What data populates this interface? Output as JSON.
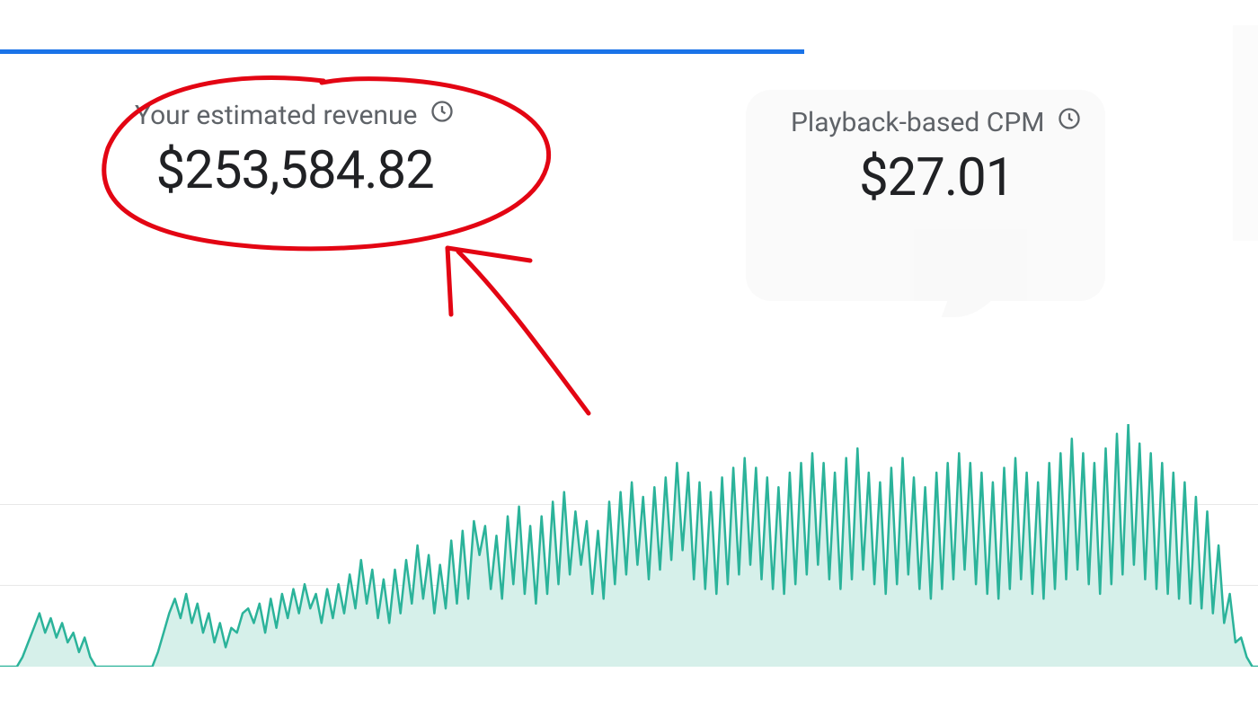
{
  "metrics": {
    "revenue": {
      "label": "Your estimated revenue",
      "value": "$253,584.82"
    },
    "cpm": {
      "label": "Playback-based CPM",
      "value": "$27.01"
    }
  },
  "colors": {
    "accent": "#1a73e8",
    "chart_line": "#2bb39a",
    "chart_fill": "#d6f0ea",
    "annotation": "#e30513"
  },
  "chart_data": {
    "type": "area",
    "title": "",
    "xlabel": "",
    "ylabel": "",
    "ylim": [
      0,
      100
    ],
    "values": [
      0,
      0,
      0,
      0,
      4,
      10,
      16,
      22,
      14,
      20,
      12,
      18,
      10,
      14,
      6,
      12,
      4,
      0,
      0,
      0,
      0,
      0,
      0,
      0,
      0,
      0,
      0,
      0,
      6,
      14,
      22,
      28,
      20,
      30,
      18,
      26,
      14,
      22,
      10,
      18,
      8,
      16,
      14,
      22,
      24,
      18,
      26,
      14,
      28,
      16,
      30,
      20,
      32,
      22,
      34,
      24,
      30,
      18,
      32,
      20,
      34,
      22,
      38,
      24,
      44,
      26,
      40,
      20,
      36,
      18,
      40,
      22,
      44,
      26,
      50,
      28,
      46,
      22,
      42,
      24,
      52,
      26,
      56,
      28,
      60,
      46,
      58,
      32,
      54,
      28,
      62,
      34,
      66,
      30,
      58,
      26,
      62,
      30,
      68,
      34,
      72,
      38,
      64,
      42,
      60,
      30,
      56,
      28,
      68,
      34,
      72,
      38,
      76,
      42,
      70,
      36,
      74,
      40,
      78,
      44,
      84,
      48,
      80,
      36,
      76,
      32,
      72,
      30,
      78,
      34,
      82,
      38,
      86,
      42,
      82,
      36,
      78,
      32,
      74,
      30,
      80,
      34,
      84,
      38,
      88,
      42,
      84,
      36,
      80,
      32,
      86,
      36,
      90,
      40,
      80,
      34,
      76,
      30,
      82,
      34,
      86,
      38,
      78,
      32,
      74,
      28,
      80,
      32,
      84,
      36,
      88,
      40,
      84,
      34,
      80,
      30,
      76,
      28,
      82,
      32,
      86,
      36,
      80,
      30,
      76,
      28,
      84,
      32,
      88,
      36,
      94,
      40,
      88,
      34,
      84,
      30,
      90,
      34,
      96,
      38,
      100,
      42,
      92,
      36,
      88,
      32,
      84,
      30,
      80,
      28,
      76,
      26,
      70,
      24,
      64,
      22,
      50,
      18,
      30,
      10,
      12,
      4,
      0,
      0
    ]
  }
}
